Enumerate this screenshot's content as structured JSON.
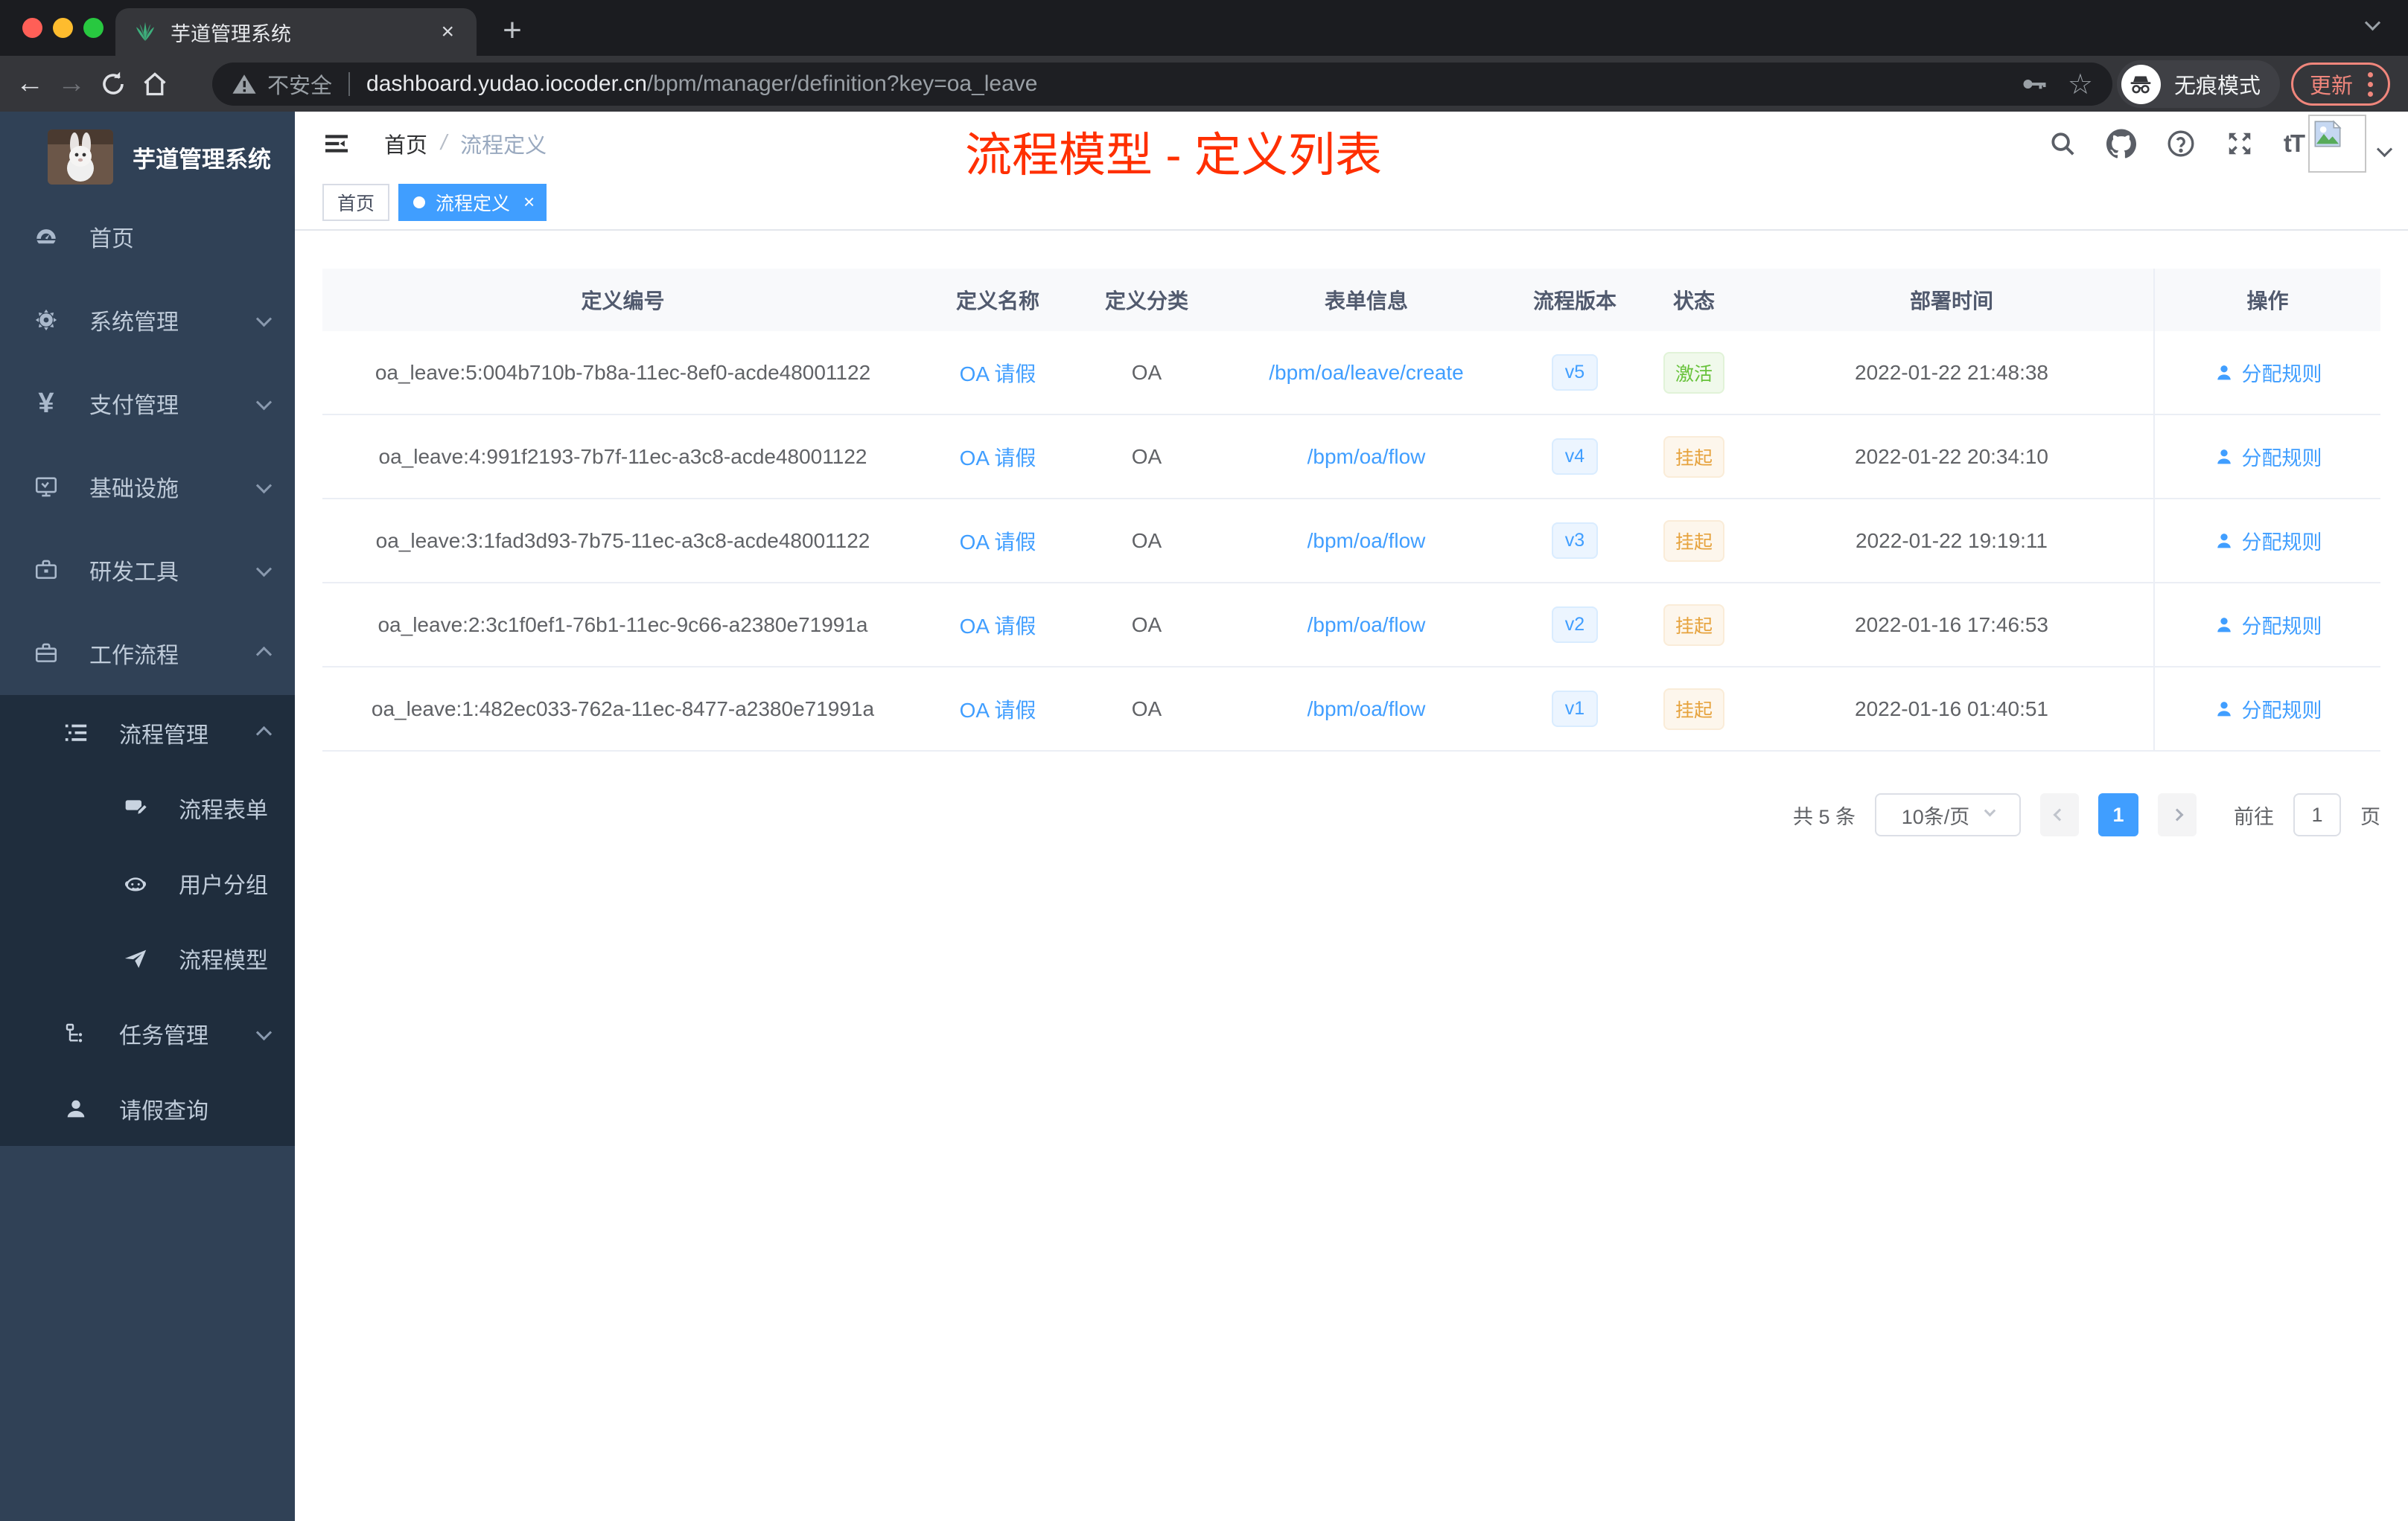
{
  "browser": {
    "tab_title": "芋道管理系统",
    "security_label": "不安全",
    "url_host": "dashboard.yudao.iocoder.cn",
    "url_path": "/bpm/manager/definition?key=oa_leave",
    "incognito_label": "无痕模式",
    "update_label": "更新"
  },
  "icons": {
    "plus": "+",
    "close": "×",
    "back": "←",
    "forward": "→",
    "star": "☆",
    "question": "?",
    "font_size": "tT",
    "tab_dot": "●"
  },
  "sidebar": {
    "logo_title": "芋道管理系统",
    "items": [
      {
        "label": "首页",
        "expandable": false
      },
      {
        "label": "系统管理",
        "expandable": true
      },
      {
        "label": "支付管理",
        "expandable": true
      },
      {
        "label": "基础设施",
        "expandable": true
      },
      {
        "label": "研发工具",
        "expandable": true
      },
      {
        "label": "工作流程",
        "expandable": true,
        "expanded": true
      }
    ],
    "submenu": {
      "group_label": "流程管理",
      "group_expanded": true,
      "children": [
        {
          "label": "流程表单"
        },
        {
          "label": "用户分组"
        },
        {
          "label": "流程模型"
        }
      ],
      "task_label": "任务管理",
      "leave_label": "请假查询"
    }
  },
  "header": {
    "breadcrumb_home": "首页",
    "breadcrumb_sep": "/",
    "breadcrumb_current": "流程定义",
    "annotation": "流程模型 - 定义列表"
  },
  "tags": [
    {
      "label": "首页",
      "active": false
    },
    {
      "label": "流程定义",
      "active": true
    }
  ],
  "table": {
    "columns": [
      "定义编号",
      "定义名称",
      "定义分类",
      "表单信息",
      "流程版本",
      "状态",
      "部署时间",
      "操作"
    ],
    "action_label": "分配规则",
    "rows": [
      {
        "id": "oa_leave:5:004b710b-7b8a-11ec-8ef0-acde48001122",
        "name": "OA 请假",
        "category": "OA",
        "form": "/bpm/oa/leave/create",
        "version": "v5",
        "status": "激活",
        "status_type": "success",
        "time": "2022-01-22 21:48:38"
      },
      {
        "id": "oa_leave:4:991f2193-7b7f-11ec-a3c8-acde48001122",
        "name": "OA 请假",
        "category": "OA",
        "form": "/bpm/oa/flow",
        "version": "v4",
        "status": "挂起",
        "status_type": "warning",
        "time": "2022-01-22 20:34:10"
      },
      {
        "id": "oa_leave:3:1fad3d93-7b75-11ec-a3c8-acde48001122",
        "name": "OA 请假",
        "category": "OA",
        "form": "/bpm/oa/flow",
        "version": "v3",
        "status": "挂起",
        "status_type": "warning",
        "time": "2022-01-22 19:19:11"
      },
      {
        "id": "oa_leave:2:3c1f0ef1-76b1-11ec-9c66-a2380e71991a",
        "name": "OA 请假",
        "category": "OA",
        "form": "/bpm/oa/flow",
        "version": "v2",
        "status": "挂起",
        "status_type": "warning",
        "time": "2022-01-16 17:46:53"
      },
      {
        "id": "oa_leave:1:482ec033-762a-11ec-8477-a2380e71991a",
        "name": "OA 请假",
        "category": "OA",
        "form": "/bpm/oa/flow",
        "version": "v1",
        "status": "挂起",
        "status_type": "warning",
        "time": "2022-01-16 01:40:51"
      }
    ]
  },
  "pagination": {
    "total_label": "共 5 条",
    "page_size_label": "10条/页",
    "current_page": "1",
    "goto_label": "前往",
    "goto_value": "1",
    "page_unit": "页"
  },
  "colors": {
    "primary": "#409eff",
    "success": "#67c23a",
    "warning": "#e6a23c",
    "annotation_red": "#ff2f00",
    "sidebar_bg": "#304156",
    "submenu_bg": "#1f2d3d"
  }
}
